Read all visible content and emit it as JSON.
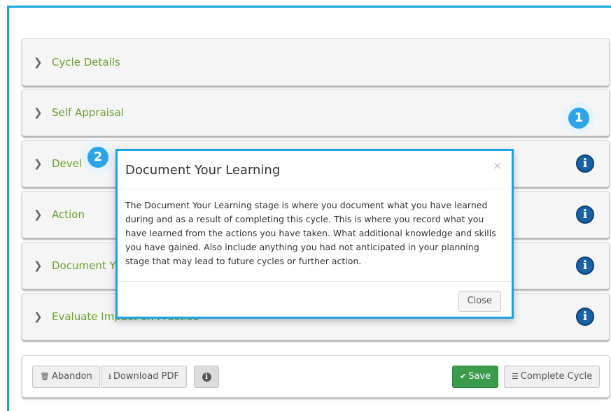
{
  "panels": [
    {
      "label": "Cycle Details"
    },
    {
      "label": "Self Appraisal"
    },
    {
      "label": "Devel"
    },
    {
      "label": "Action"
    },
    {
      "label": "Document Y"
    },
    {
      "label": "Evaluate Impact on Practice"
    }
  ],
  "badges": [
    "1",
    "2"
  ],
  "info_icon_glyph": "i",
  "modal": {
    "title": "Document Your Learning",
    "close_x": "×",
    "body": "The Document Your Learning stage is where you document what you have learned during and as a result of completing this cycle. This is where you record what you have learned from the actions you have taken. What additional knowledge and skills you have gained. Also include anything you had not anticipated in your planning stage that may lead to future cycles or further action.",
    "close_label": "Close"
  },
  "footer": {
    "abandon_label": "Abandon",
    "download_label": "Download PDF",
    "info_glyph": "i",
    "save_label": "Save",
    "complete_label": "Complete Cycle"
  },
  "colors": {
    "accent": "#1aa3de",
    "panel_title": "#6aa132",
    "info_icon": "#1863a8",
    "save": "#3b9d4b"
  }
}
